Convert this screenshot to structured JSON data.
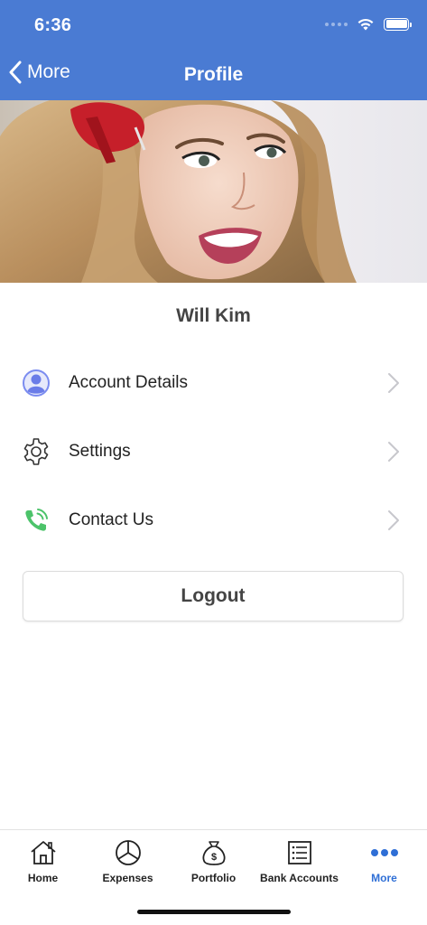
{
  "status_bar": {
    "time": "6:36"
  },
  "nav": {
    "back_label": "More",
    "title": "Profile"
  },
  "profile": {
    "name": "Will Kim"
  },
  "menu": {
    "items": [
      {
        "label": "Account Details",
        "icon": "user-circle-icon",
        "icon_color": "#7b8cf0"
      },
      {
        "label": "Settings",
        "icon": "gear-icon",
        "icon_color": "#333333"
      },
      {
        "label": "Contact Us",
        "icon": "phone-ringing-icon",
        "icon_color": "#4cc36a"
      }
    ]
  },
  "logout": {
    "label": "Logout"
  },
  "tabbar": {
    "tabs": [
      {
        "label": "Home",
        "icon": "home-icon",
        "active": false
      },
      {
        "label": "Expenses",
        "icon": "pie-chart-icon",
        "active": false
      },
      {
        "label": "Portfolio",
        "icon": "money-bag-icon",
        "active": false
      },
      {
        "label": "Bank Accounts",
        "icon": "list-icon",
        "active": false
      },
      {
        "label": "More",
        "icon": "more-dots-icon",
        "active": true
      }
    ]
  },
  "colors": {
    "header": "#4a7bd3",
    "accent": "#2f6fd6"
  }
}
